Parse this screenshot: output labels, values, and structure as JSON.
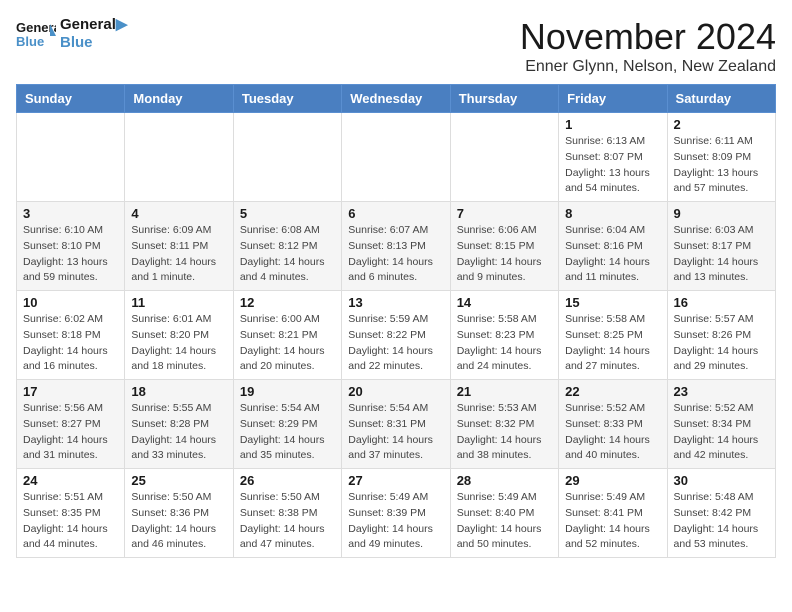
{
  "header": {
    "logo_line1": "General",
    "logo_line2": "Blue",
    "title": "November 2024",
    "subtitle": "Enner Glynn, Nelson, New Zealand"
  },
  "weekdays": [
    "Sunday",
    "Monday",
    "Tuesday",
    "Wednesday",
    "Thursday",
    "Friday",
    "Saturday"
  ],
  "weeks": [
    [
      {
        "day": "",
        "info": ""
      },
      {
        "day": "",
        "info": ""
      },
      {
        "day": "",
        "info": ""
      },
      {
        "day": "",
        "info": ""
      },
      {
        "day": "",
        "info": ""
      },
      {
        "day": "1",
        "info": "Sunrise: 6:13 AM\nSunset: 8:07 PM\nDaylight: 13 hours\nand 54 minutes."
      },
      {
        "day": "2",
        "info": "Sunrise: 6:11 AM\nSunset: 8:09 PM\nDaylight: 13 hours\nand 57 minutes."
      }
    ],
    [
      {
        "day": "3",
        "info": "Sunrise: 6:10 AM\nSunset: 8:10 PM\nDaylight: 13 hours\nand 59 minutes."
      },
      {
        "day": "4",
        "info": "Sunrise: 6:09 AM\nSunset: 8:11 PM\nDaylight: 14 hours\nand 1 minute."
      },
      {
        "day": "5",
        "info": "Sunrise: 6:08 AM\nSunset: 8:12 PM\nDaylight: 14 hours\nand 4 minutes."
      },
      {
        "day": "6",
        "info": "Sunrise: 6:07 AM\nSunset: 8:13 PM\nDaylight: 14 hours\nand 6 minutes."
      },
      {
        "day": "7",
        "info": "Sunrise: 6:06 AM\nSunset: 8:15 PM\nDaylight: 14 hours\nand 9 minutes."
      },
      {
        "day": "8",
        "info": "Sunrise: 6:04 AM\nSunset: 8:16 PM\nDaylight: 14 hours\nand 11 minutes."
      },
      {
        "day": "9",
        "info": "Sunrise: 6:03 AM\nSunset: 8:17 PM\nDaylight: 14 hours\nand 13 minutes."
      }
    ],
    [
      {
        "day": "10",
        "info": "Sunrise: 6:02 AM\nSunset: 8:18 PM\nDaylight: 14 hours\nand 16 minutes."
      },
      {
        "day": "11",
        "info": "Sunrise: 6:01 AM\nSunset: 8:20 PM\nDaylight: 14 hours\nand 18 minutes."
      },
      {
        "day": "12",
        "info": "Sunrise: 6:00 AM\nSunset: 8:21 PM\nDaylight: 14 hours\nand 20 minutes."
      },
      {
        "day": "13",
        "info": "Sunrise: 5:59 AM\nSunset: 8:22 PM\nDaylight: 14 hours\nand 22 minutes."
      },
      {
        "day": "14",
        "info": "Sunrise: 5:58 AM\nSunset: 8:23 PM\nDaylight: 14 hours\nand 24 minutes."
      },
      {
        "day": "15",
        "info": "Sunrise: 5:58 AM\nSunset: 8:25 PM\nDaylight: 14 hours\nand 27 minutes."
      },
      {
        "day": "16",
        "info": "Sunrise: 5:57 AM\nSunset: 8:26 PM\nDaylight: 14 hours\nand 29 minutes."
      }
    ],
    [
      {
        "day": "17",
        "info": "Sunrise: 5:56 AM\nSunset: 8:27 PM\nDaylight: 14 hours\nand 31 minutes."
      },
      {
        "day": "18",
        "info": "Sunrise: 5:55 AM\nSunset: 8:28 PM\nDaylight: 14 hours\nand 33 minutes."
      },
      {
        "day": "19",
        "info": "Sunrise: 5:54 AM\nSunset: 8:29 PM\nDaylight: 14 hours\nand 35 minutes."
      },
      {
        "day": "20",
        "info": "Sunrise: 5:54 AM\nSunset: 8:31 PM\nDaylight: 14 hours\nand 37 minutes."
      },
      {
        "day": "21",
        "info": "Sunrise: 5:53 AM\nSunset: 8:32 PM\nDaylight: 14 hours\nand 38 minutes."
      },
      {
        "day": "22",
        "info": "Sunrise: 5:52 AM\nSunset: 8:33 PM\nDaylight: 14 hours\nand 40 minutes."
      },
      {
        "day": "23",
        "info": "Sunrise: 5:52 AM\nSunset: 8:34 PM\nDaylight: 14 hours\nand 42 minutes."
      }
    ],
    [
      {
        "day": "24",
        "info": "Sunrise: 5:51 AM\nSunset: 8:35 PM\nDaylight: 14 hours\nand 44 minutes."
      },
      {
        "day": "25",
        "info": "Sunrise: 5:50 AM\nSunset: 8:36 PM\nDaylight: 14 hours\nand 46 minutes."
      },
      {
        "day": "26",
        "info": "Sunrise: 5:50 AM\nSunset: 8:38 PM\nDaylight: 14 hours\nand 47 minutes."
      },
      {
        "day": "27",
        "info": "Sunrise: 5:49 AM\nSunset: 8:39 PM\nDaylight: 14 hours\nand 49 minutes."
      },
      {
        "day": "28",
        "info": "Sunrise: 5:49 AM\nSunset: 8:40 PM\nDaylight: 14 hours\nand 50 minutes."
      },
      {
        "day": "29",
        "info": "Sunrise: 5:49 AM\nSunset: 8:41 PM\nDaylight: 14 hours\nand 52 minutes."
      },
      {
        "day": "30",
        "info": "Sunrise: 5:48 AM\nSunset: 8:42 PM\nDaylight: 14 hours\nand 53 minutes."
      }
    ]
  ]
}
